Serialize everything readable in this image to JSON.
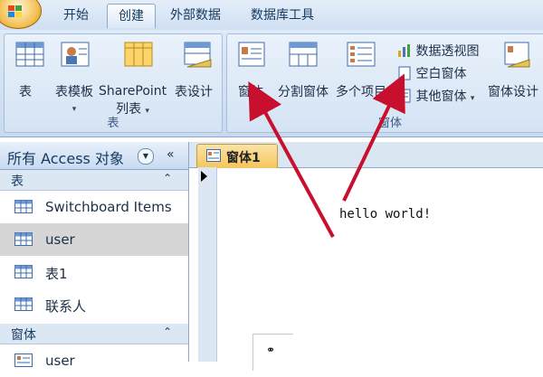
{
  "tabs": [
    "开始",
    "创建",
    "外部数据",
    "数据库工具"
  ],
  "ribbon": {
    "table_group": {
      "label": "表",
      "buttons": [
        "表",
        "表模板",
        "SharePoint\n列表",
        "表设计"
      ]
    },
    "form_group": {
      "label": "窗体",
      "buttons": [
        "窗体",
        "分割窗体",
        "多个项目"
      ],
      "small_buttons": [
        "数据透视图",
        "空白窗体",
        "其他窗体"
      ],
      "form_design": "窗体设计"
    }
  },
  "nav": {
    "title": "所有 Access 对象",
    "sections": [
      {
        "title": "表",
        "items": [
          "Switchboard Items",
          "user",
          "表1",
          "联系人"
        ]
      },
      {
        "title": "窗体",
        "items": [
          "user"
        ]
      }
    ],
    "selected": "user"
  },
  "document": {
    "tab_label": "窗体1",
    "body_text": "hello world!"
  },
  "colors": {
    "arrow": "#c8102e",
    "accent": "#f5c55c"
  }
}
